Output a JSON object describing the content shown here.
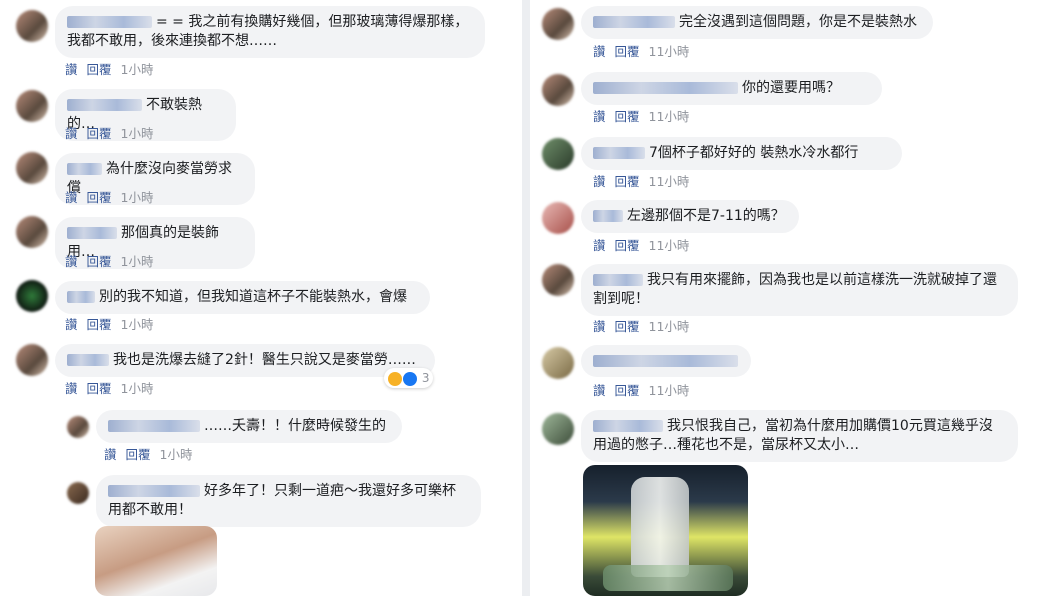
{
  "left_comments": [
    {
      "text": "= = 我之前有換購好幾個，但那玻璃薄得爆那樣，我都不敢用，後來連換都不想……",
      "like": "讚",
      "reply": "回覆",
      "time": "1小時"
    },
    {
      "text": "不敢裝熱的…",
      "like": "讚",
      "reply": "回覆",
      "time": "1小時"
    },
    {
      "text": "為什麼沒向麥當勞求償",
      "like": "讚",
      "reply": "回覆",
      "time": "1小時"
    },
    {
      "text": "那個真的是裝飾用…",
      "like": "讚",
      "reply": "回覆",
      "time": "1小時"
    },
    {
      "text": "別的我不知道，但我知道這杯子不能裝熱水，會爆",
      "like": "讚",
      "reply": "回覆",
      "time": "1小時"
    },
    {
      "text": "我也是洗爆去縫了2針！醫生只說又是麥當勞……",
      "like": "讚",
      "reply": "回覆",
      "time": "1小時",
      "reaction_count": "3"
    }
  ],
  "left_replies": [
    {
      "text": "……夭壽！！什麼時候發生的",
      "like": "讚",
      "reply": "回覆",
      "time": "1小時"
    },
    {
      "text": "好多年了！只剩一道疤～我還好多可樂杯用都不敢用！"
    }
  ],
  "right_comments": [
    {
      "text": "完全沒遇到這個問題，你是不是裝熱水",
      "like": "讚",
      "reply": "回覆",
      "time": "11小時"
    },
    {
      "text": "你的還要用嗎？",
      "like": "讚",
      "reply": "回覆",
      "time": "11小時"
    },
    {
      "text": "7個杯子都好好的 裝熱水冷水都行",
      "like": "讚",
      "reply": "回覆",
      "time": "11小時"
    },
    {
      "text": "左邊那個不是7-11的嗎？",
      "like": "讚",
      "reply": "回覆",
      "time": "11小時"
    },
    {
      "text": "我只有用來擺飾，因為我也是以前這樣洗一洗就破掉了還割到呢！",
      "like": "讚",
      "reply": "回覆",
      "time": "11小時"
    },
    {
      "text": "",
      "like": "讚",
      "reply": "回覆",
      "time": "11小時"
    },
    {
      "text": "我只恨我自己，當初為什麼用加購價10元買這幾乎沒用過的憋子…種花也不是，當尿杯又太小…"
    }
  ]
}
